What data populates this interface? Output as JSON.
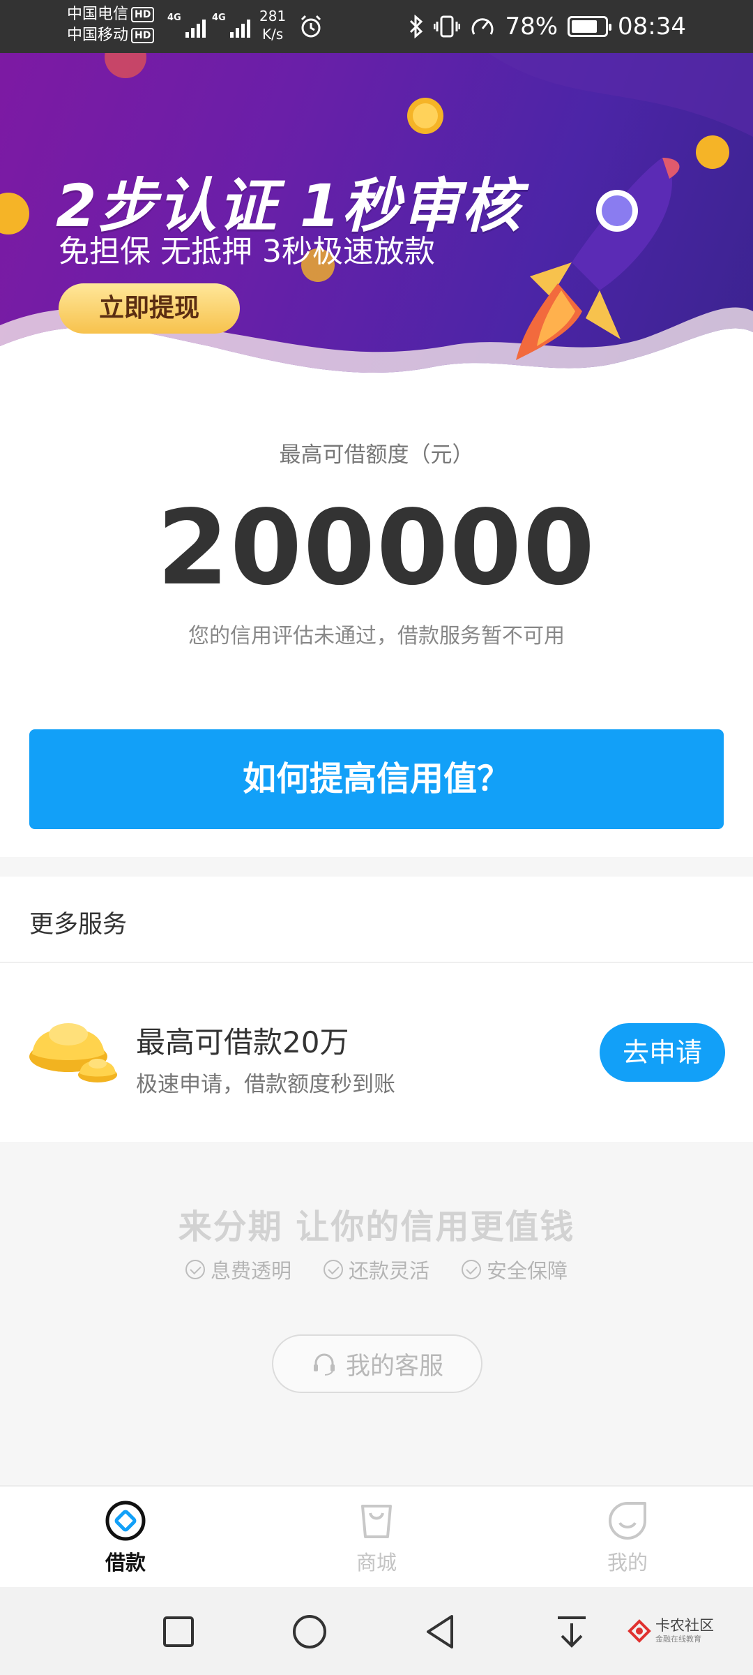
{
  "status_bar": {
    "carrier1": "中国电信",
    "carrier2": "中国移动",
    "hd_badge": "HD",
    "network1": "4G",
    "network2": "4G",
    "speed_value": "281",
    "speed_unit": "K/s",
    "battery_percent": "78%",
    "battery_level": 0.78,
    "time": "08:34"
  },
  "banner": {
    "title": "2步认证 1秒审核",
    "subtitle": "免担保 无抵押 3秒极速放款",
    "cta_label": "立即提现",
    "colors": {
      "gradient_start": "#7d1aa3",
      "gradient_end": "#3b238f",
      "cta": "#f7c24d"
    }
  },
  "credit": {
    "label": "最高可借额度（元）",
    "amount": "200000",
    "note": "您的信用评估未通过，借款服务暂不可用",
    "primary_button": "如何提高信用值？"
  },
  "more_services": {
    "header": "更多服务",
    "items": [
      {
        "icon": "gold-ingot-icon",
        "title": "最高可借款20万",
        "desc": "极速申请，借款额度秒到账",
        "button": "去申请"
      }
    ]
  },
  "promo": {
    "slogan": "来分期 让你的信用更值钱",
    "features": [
      "息费透明",
      "还款灵活",
      "安全保障"
    ],
    "service_button": "我的客服"
  },
  "tabs": [
    {
      "label": "借款",
      "icon": "loan-icon",
      "active": true
    },
    {
      "label": "商城",
      "icon": "mall-bag-icon",
      "active": false
    },
    {
      "label": "我的",
      "icon": "profile-face-icon",
      "active": false
    }
  ],
  "watermark": {
    "name": "卡农社区",
    "sub": "金融在线教育"
  },
  "colors": {
    "accent": "#12a0f8",
    "status_bar": "#333333"
  }
}
